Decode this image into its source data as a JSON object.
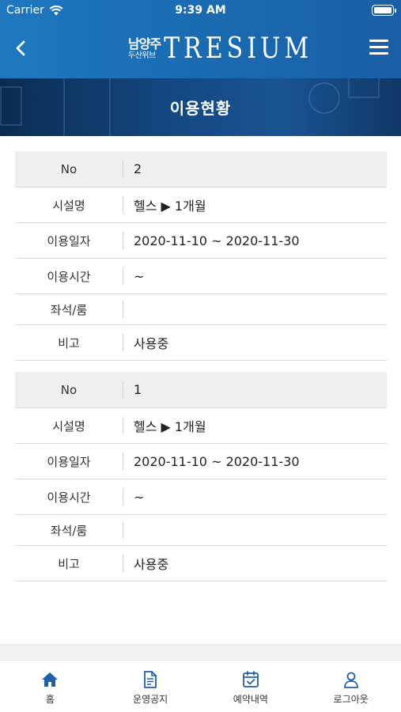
{
  "status_bar": {
    "carrier": "Carrier",
    "time": "9:39 AM"
  },
  "header": {
    "logo_korean_line1": "남양주",
    "logo_korean_line2": "두산위브",
    "logo_english": "TRESIUM"
  },
  "banner": {
    "title": "이용현황"
  },
  "records": [
    {
      "no_label": "No",
      "no_value": "2",
      "facility_label": "시설명",
      "facility_value": "헬스 ▶ 1개월",
      "date_label": "이용일자",
      "date_value": "2020-11-10 ~ 2020-11-30",
      "time_label": "이용시간",
      "time_value": "~",
      "seat_label": "좌석/룸",
      "seat_value": "",
      "note_label": "비고",
      "note_value": "사용중"
    },
    {
      "no_label": "No",
      "no_value": "1",
      "facility_label": "시설명",
      "facility_value": "헬스 ▶ 1개월",
      "date_label": "이용일자",
      "date_value": "2020-11-10 ~ 2020-11-30",
      "time_label": "이용시간",
      "time_value": "~",
      "seat_label": "좌석/룸",
      "seat_value": "",
      "note_label": "비고",
      "note_value": "사용중"
    }
  ],
  "tabbar": [
    {
      "label": "홈",
      "icon": "home-icon"
    },
    {
      "label": "운영공지",
      "icon": "document-icon"
    },
    {
      "label": "예약내역",
      "icon": "calendar-check-icon"
    },
    {
      "label": "로그아웃",
      "icon": "user-icon"
    }
  ],
  "colors": {
    "header_blue": "#1a6db3",
    "banner_navy": "#13467e",
    "tab_icon_blue": "#1f5fa8"
  }
}
